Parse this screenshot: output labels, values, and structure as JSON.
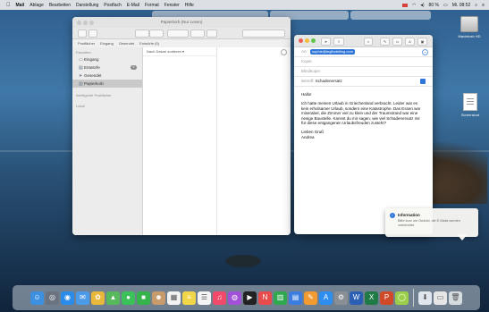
{
  "menubar": {
    "app": "Mail",
    "items": [
      "Ablage",
      "Bearbeiten",
      "Darstellung",
      "Postfach",
      "E-Mail",
      "Format",
      "Fenster",
      "Hilfe"
    ],
    "battery": "80 %",
    "clock": "Mi. 08:52"
  },
  "desktop": {
    "icon1_label": "Macintosh HD",
    "icon2_label": "Screenshot"
  },
  "mail_window": {
    "title": "Papierkorb (Nur Lesen)",
    "favorites": [
      "Postfächer",
      "Eingang",
      "Gesendet",
      "Entwürfe (5)"
    ],
    "sidebar_header": "Favoriten",
    "sidebar_items": [
      {
        "label": "Eingang",
        "icon": "inbox-icon"
      },
      {
        "label": "Entwürfe",
        "icon": "drafts-icon",
        "badge": "5"
      },
      {
        "label": "Gesendet",
        "icon": "sent-icon"
      },
      {
        "label": "Papierkorb",
        "icon": "trash-icon",
        "selected": true
      }
    ],
    "smart_header": "Intelligente Postfächer",
    "icloud_header": "Lokal",
    "sort_label": "Nach Datum sortieren ▾"
  },
  "compose": {
    "to_label": "An:",
    "to_value": "sophie@teglhotelling.com",
    "cc_label": "Kopie:",
    "bcc_label": "Blindkopie:",
    "subject_label": "Betreff:",
    "subject_value": "Schadenersatz",
    "body": {
      "greeting": "Hallo!",
      "para": "Ich hatte meinen Urlaub in Griechenland verbracht. Leider war es kein erholsamer Urlaub, sondern eine Katastrophe. Das Essen war miserabel, die Zimmer viel zu klein und der Traumstrand war eine riesige Baustelle. Kannst du mir sagen, wie viel Schadenersatz mir für diese entgangenen Urlaubsfreuden zusteht?",
      "closing": "Lieben Gruß",
      "name": "Andrea"
    }
  },
  "notification": {
    "title": "Information",
    "body": "Bitte kurz um Geduld, die E-Mails werden vorbereitet."
  },
  "dock_apps": [
    {
      "name": "finder",
      "color": "#3d8fe0",
      "glyph": "☺"
    },
    {
      "name": "launchpad",
      "color": "#6b7280",
      "glyph": "◎"
    },
    {
      "name": "safari",
      "color": "#2a8be8",
      "glyph": "◉"
    },
    {
      "name": "mail",
      "color": "#4c9be8",
      "glyph": "✉"
    },
    {
      "name": "photos",
      "color": "#e9b83a",
      "glyph": "✿"
    },
    {
      "name": "maps",
      "color": "#58b85c",
      "glyph": "▲"
    },
    {
      "name": "messages",
      "color": "#3cc05a",
      "glyph": "●"
    },
    {
      "name": "facetime",
      "color": "#36b44b",
      "glyph": "■"
    },
    {
      "name": "contacts",
      "color": "#c79b6b",
      "glyph": "☻"
    },
    {
      "name": "calendar",
      "color": "#f2f2f2",
      "glyph": "▦"
    },
    {
      "name": "notes",
      "color": "#f1d64a",
      "glyph": "≡"
    },
    {
      "name": "reminders",
      "color": "#f4f4f4",
      "glyph": "☰"
    },
    {
      "name": "music",
      "color": "#f24a6a",
      "glyph": "♫"
    },
    {
      "name": "podcasts",
      "color": "#a150d8",
      "glyph": "◍"
    },
    {
      "name": "tv",
      "color": "#222222",
      "glyph": "▶"
    },
    {
      "name": "news",
      "color": "#e74b4b",
      "glyph": "N"
    },
    {
      "name": "numbers",
      "color": "#2fa84f",
      "glyph": "▥"
    },
    {
      "name": "keynote",
      "color": "#3b7de0",
      "glyph": "▤"
    },
    {
      "name": "pages",
      "color": "#f29b33",
      "glyph": "✎"
    },
    {
      "name": "appstore",
      "color": "#2d8ef0",
      "glyph": "A"
    },
    {
      "name": "settings",
      "color": "#8a8f96",
      "glyph": "⚙"
    },
    {
      "name": "word",
      "color": "#2b5fb4",
      "glyph": "W"
    },
    {
      "name": "excel",
      "color": "#1f7a45",
      "glyph": "X"
    },
    {
      "name": "powerpoint",
      "color": "#d04a2a",
      "glyph": "P"
    },
    {
      "name": "app-green",
      "color": "#9bcf4a",
      "glyph": "◯"
    }
  ],
  "dock_right": [
    {
      "name": "downloads",
      "color": "#dfe6ee",
      "glyph": "⬇"
    },
    {
      "name": "preview",
      "color": "#e6e6e6",
      "glyph": "▭"
    },
    {
      "name": "trash",
      "color": "#d6dbe0",
      "glyph": "🗑"
    }
  ],
  "colors": {
    "accent": "#2f76d8"
  }
}
